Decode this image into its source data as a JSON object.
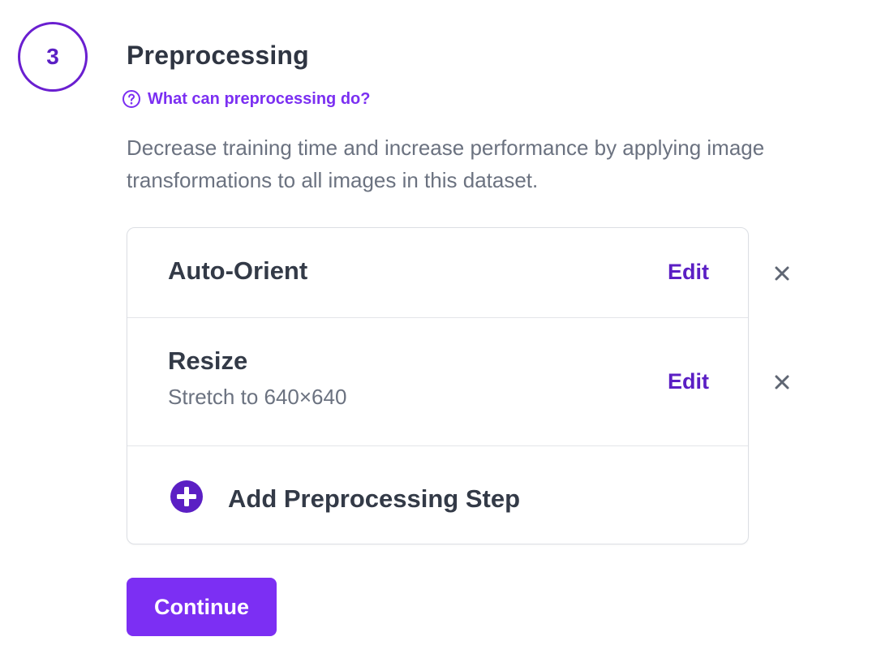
{
  "step": {
    "number": "3",
    "title": "Preprocessing",
    "help_link": "What can preprocessing do?",
    "description": "Decrease training time and increase performance by applying image transformations to all images in this dataset."
  },
  "preprocessing_steps": [
    {
      "title": "Auto-Orient",
      "subtitle": "",
      "edit_label": "Edit",
      "remove_icon": "close-icon"
    },
    {
      "title": "Resize",
      "subtitle": "Stretch to 640×640",
      "edit_label": "Edit",
      "remove_icon": "close-icon"
    }
  ],
  "add_step": {
    "label": "Add Preprocessing Step",
    "icon": "plus-circle-icon"
  },
  "continue_label": "Continue",
  "colors": {
    "accent": "#7c2ff3",
    "accent_dark": "#5b1fc4",
    "title_text": "#333a47",
    "muted_text": "#6b7280",
    "border": "#dcdfe4"
  }
}
